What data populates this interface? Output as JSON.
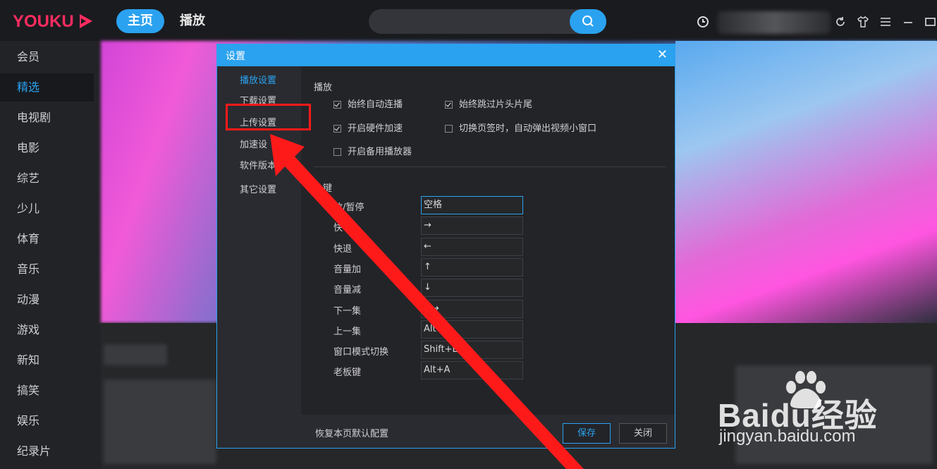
{
  "app": {
    "logo": "YOUKU",
    "nav": {
      "home": "主页",
      "play": "播放"
    }
  },
  "sidebar": {
    "items": [
      {
        "label": "会员",
        "active": false
      },
      {
        "label": "精选",
        "active": true
      },
      {
        "label": "电视剧",
        "active": false
      },
      {
        "label": "电影",
        "active": false
      },
      {
        "label": "综艺",
        "active": false
      },
      {
        "label": "少儿",
        "active": false
      },
      {
        "label": "体育",
        "active": false
      },
      {
        "label": "音乐",
        "active": false
      },
      {
        "label": "动漫",
        "active": false
      },
      {
        "label": "游戏",
        "active": false
      },
      {
        "label": "新知",
        "active": false
      },
      {
        "label": "搞笑",
        "active": false
      },
      {
        "label": "娱乐",
        "active": false
      },
      {
        "label": "纪录片",
        "active": false
      }
    ]
  },
  "dialog": {
    "title": "设置",
    "close": "✕",
    "nav": [
      "播放设置",
      "下载设置",
      "上传设置",
      "加速设",
      "软件版本",
      "其它设置"
    ],
    "play_section": "播放",
    "options": {
      "auto_continue": "始终自动连播",
      "skip_intro": "始终跳过片头片尾",
      "hw_accel": "开启硬件加速",
      "popup_window": "切换页签时，自动弹出视频小窗口",
      "backup_player": "开启备用播放器"
    },
    "hotkey_section": "键",
    "hotkeys": [
      {
        "label": "放/暂停",
        "value": "空格"
      },
      {
        "label": "快",
        "value": "→"
      },
      {
        "label": "快退",
        "value": "←"
      },
      {
        "label": "音量加",
        "value": "↑"
      },
      {
        "label": "音量减",
        "value": "↓"
      },
      {
        "label": "下一集",
        "value": "+→"
      },
      {
        "label": "上一集",
        "value": "Alt+"
      },
      {
        "label": "窗口模式切换",
        "value": "Shift+En"
      },
      {
        "label": "老板键",
        "value": "Alt+A"
      }
    ],
    "footer": {
      "reset": "恢复本页默认配置",
      "save": "保存",
      "close": "关闭"
    }
  },
  "watermark": {
    "line1": "Baidu经验",
    "line2": "jingyan.baidu.com"
  },
  "colors": {
    "accent": "#2aa2f0",
    "brand": "#ff2c60",
    "annotation": "#ff1a1a"
  }
}
